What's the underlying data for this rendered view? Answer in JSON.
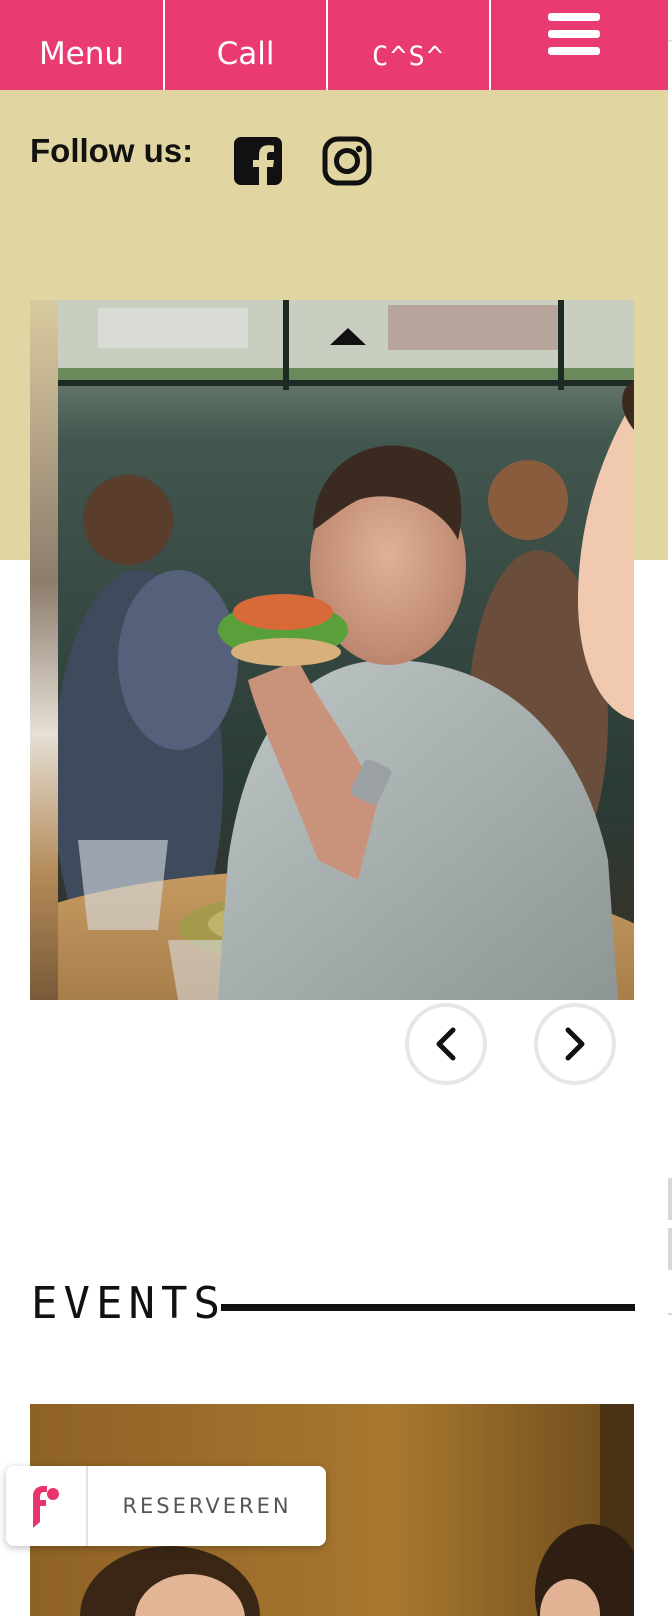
{
  "nav": {
    "menu_label": "Menu",
    "call_label": "Call",
    "logo_text": "C^S^",
    "hamburger_icon": "hamburger-icon",
    "background": "#ea3a72"
  },
  "follow": {
    "label": "Follow us:",
    "icons": [
      "facebook-icon",
      "instagram-icon"
    ]
  },
  "band_color": "#e1d6a1",
  "slider": {
    "prev_icon": "chevron-left-icon",
    "next_icon": "chevron-right-icon"
  },
  "events": {
    "title": "EVENTS"
  },
  "reservation": {
    "button_label": "RESERVEREN",
    "brand_color": "#e8336d"
  }
}
